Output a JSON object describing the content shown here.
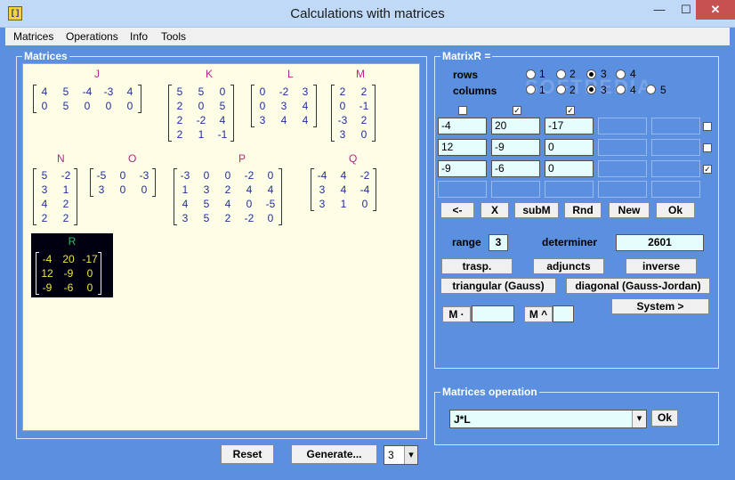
{
  "window": {
    "title": "Calculations with matrices",
    "icon_glyph": "[]",
    "min": "—",
    "max": "☐",
    "close": "✕"
  },
  "menu": [
    "Matrices",
    "Operations",
    "Info",
    "Tools"
  ],
  "matrices_panel": {
    "title": "Matrices",
    "J": {
      "label": "J",
      "rows": [
        [
          "4",
          "5",
          "-4",
          "-3",
          "4"
        ],
        [
          "0",
          "5",
          "0",
          "0",
          "0"
        ]
      ]
    },
    "K": {
      "label": "K",
      "rows": [
        [
          "5",
          "5",
          "0"
        ],
        [
          "2",
          "0",
          "5"
        ],
        [
          "2",
          "-2",
          "4"
        ],
        [
          "2",
          "1",
          "-1"
        ]
      ]
    },
    "L": {
      "label": "L",
      "rows": [
        [
          "0",
          "-2",
          "3"
        ],
        [
          "0",
          "3",
          "4"
        ],
        [
          "3",
          "4",
          "4"
        ]
      ]
    },
    "M": {
      "label": "M",
      "rows": [
        [
          "2",
          "2"
        ],
        [
          "0",
          "-1"
        ],
        [
          "-3",
          "2"
        ],
        [
          "3",
          "0"
        ]
      ]
    },
    "N": {
      "label": "N",
      "rows": [
        [
          "5",
          "-2"
        ],
        [
          "3",
          "1"
        ],
        [
          "4",
          "2"
        ],
        [
          "2",
          "2"
        ]
      ]
    },
    "O": {
      "label": "O",
      "rows": [
        [
          "-5",
          "0",
          "-3"
        ],
        [
          "3",
          "0",
          "0"
        ]
      ]
    },
    "P": {
      "label": "P",
      "rows": [
        [
          "-3",
          "0",
          "0",
          "-2",
          "0"
        ],
        [
          "1",
          "3",
          "2",
          "4",
          "4"
        ],
        [
          "4",
          "5",
          "4",
          "0",
          "-5"
        ],
        [
          "3",
          "5",
          "2",
          "-2",
          "0"
        ]
      ]
    },
    "Q": {
      "label": "Q",
      "rows": [
        [
          "-4",
          "4",
          "-2"
        ],
        [
          "3",
          "4",
          "-4"
        ],
        [
          "3",
          "1",
          "0"
        ]
      ]
    },
    "R": {
      "label": "R",
      "rows": [
        [
          "-4",
          "20",
          "-17"
        ],
        [
          "12",
          "-9",
          "0"
        ],
        [
          "-9",
          "-6",
          "0"
        ]
      ]
    }
  },
  "bottom": {
    "reset": "Reset",
    "generate": "Generate...",
    "count": "3",
    "dropdown_arrow": "▾"
  },
  "matrixR": {
    "title": "MatrixR =",
    "rows_label": "rows",
    "columns_label": "columns",
    "row_options": [
      "1",
      "2",
      "3",
      "4"
    ],
    "column_options": [
      "1",
      "2",
      "3",
      "4",
      "5"
    ],
    "row_checks": [
      "",
      "✓",
      "✓"
    ],
    "side_checks": [
      "",
      "",
      "✓"
    ],
    "grid": [
      [
        "-4",
        "20",
        "-17",
        "",
        ""
      ],
      [
        "12",
        "-9",
        "0",
        "",
        ""
      ],
      [
        "-9",
        "-6",
        "0",
        "",
        ""
      ],
      [
        "",
        "",
        "",
        "",
        ""
      ]
    ],
    "buttons": {
      "back": "<-",
      "clear": "X",
      "subm": "subM",
      "rnd": "Rnd",
      "new": "New",
      "ok": "Ok"
    },
    "range_label": "range",
    "range_value": "3",
    "determiner_label": "determiner",
    "determiner_value": "2601",
    "trasp": "trasp.",
    "adjuncts": "adjuncts",
    "inverse": "inverse",
    "triangular": "triangular (Gauss)",
    "diagonal": "diagonal (Gauss-Jordan)",
    "system": "System >",
    "m_dot": "M ·",
    "m_pow": "M ^",
    "m_dot_value": "",
    "m_pow_value": ""
  },
  "operation": {
    "title": "Matrices operation",
    "value": "J*L",
    "ok": "Ok",
    "arrow": "▾"
  },
  "watermark": "SOFTPEDIA"
}
